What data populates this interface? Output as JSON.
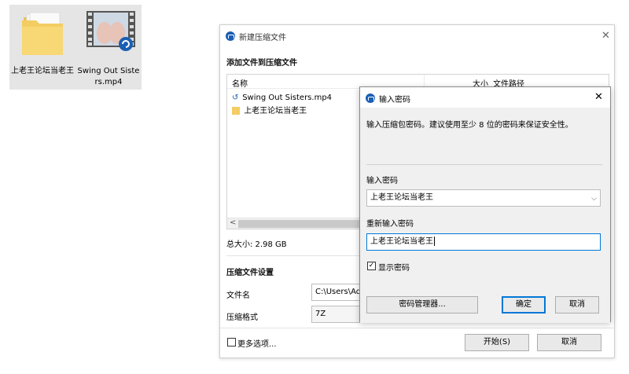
{
  "desktop": {
    "icons": [
      {
        "label": "上老王论坛当老王",
        "icon": "folder-icon"
      },
      {
        "label": "Swing Out Sisters.mp4",
        "icon": "video-file-icon"
      }
    ]
  },
  "compress_dialog": {
    "title": "新建压缩文件",
    "add_files_heading": "添加文件到压缩文件",
    "columns": {
      "name": "名称",
      "size": "大小",
      "path": "文件路径"
    },
    "files": [
      {
        "name": "Swing Out Sisters.mp4",
        "icon": "media-file-icon"
      },
      {
        "name": "上老王论坛当老王",
        "icon": "folder-icon"
      }
    ],
    "total_size": "总大小: 2.98 GB",
    "settings_heading": "压缩文件设置",
    "filename_label": "文件名",
    "filename_value": "C:\\Users\\Ad",
    "format_label": "压缩格式",
    "format_value": "7Z",
    "more_options": "更多选项...",
    "start_button": "开始(S)",
    "cancel_button": "取消"
  },
  "password_dialog": {
    "title": "输入密码",
    "description": "输入压缩包密码。建议使用至少 8 位的密码来保证安全性。",
    "password_label": "输入密码",
    "password_value": "上老王论坛当老王",
    "confirm_label": "重新输入密码",
    "confirm_value": "上老王论坛当老王",
    "show_password_label": "显示密码",
    "show_password_checked": true,
    "manager_button": "密码管理器...",
    "ok_button": "确定",
    "cancel_button": "取消"
  },
  "colors": {
    "accent": "#0078d7",
    "title_icon": "#1a5fb4",
    "dialog_bg": "#f0f0f0"
  }
}
